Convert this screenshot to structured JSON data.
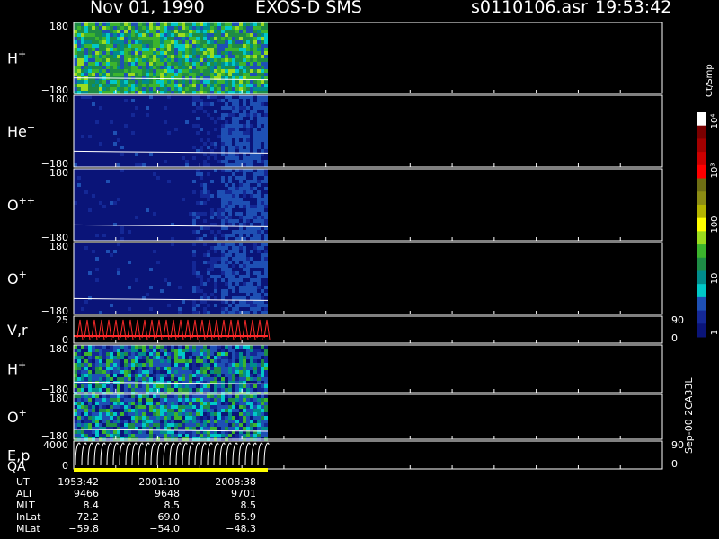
{
  "header": {
    "date": "Nov 01, 1990",
    "instrument": "EXOS-D SMS",
    "file": "s0110106.asr",
    "time": "19:53:42"
  },
  "panels": [
    {
      "label": "H",
      "sup": "+",
      "ymax": "180",
      "ymin": "−180"
    },
    {
      "label": "He",
      "sup": "+",
      "ymax": "180",
      "ymin": "−180"
    },
    {
      "label": "O",
      "sup": "++",
      "ymax": "180",
      "ymin": "−180"
    },
    {
      "label": "O",
      "sup": "+",
      "ymax": "180",
      "ymin": "−180"
    },
    {
      "label": "V,r",
      "sup": "",
      "ymax": "25",
      "ymin": "0",
      "rmax": "90",
      "rmin": "0"
    },
    {
      "label": "H",
      "sup": "+",
      "ymax": "180",
      "ymin": "−180"
    },
    {
      "label": "O",
      "sup": "+",
      "ymax": "180",
      "ymin": "−180"
    },
    {
      "label": "E,p",
      "sup": "",
      "ymax": "4000",
      "ymin": "0",
      "rmax": "90",
      "rmin": "0"
    }
  ],
  "qa_label": "QA",
  "colorbar": {
    "unit": "Ct/Smp",
    "ticks": [
      "10⁴",
      "10³",
      "100",
      "10",
      "1"
    ],
    "colors": [
      "#ffffff",
      "#7a0000",
      "#a30000",
      "#cc0000",
      "#ff0000",
      "#6e6e14",
      "#8c8c14",
      "#b4b400",
      "#ffff00",
      "#9bdc1e",
      "#3cb42d",
      "#1e8c46",
      "#008c8c",
      "#00c8c8",
      "#1e50b4",
      "#142896",
      "#0a1478"
    ]
  },
  "stamp": "Sep-00 2CA33L",
  "footer": {
    "rows": [
      {
        "name": "UT",
        "values": [
          "1953:42",
          "2001:10",
          "2008:38"
        ]
      },
      {
        "name": "ALT",
        "values": [
          "9466",
          "9648",
          "9701"
        ]
      },
      {
        "name": "MLT",
        "values": [
          "8.4",
          "8.5",
          "8.5"
        ]
      },
      {
        "name": "InLat",
        "values": [
          "72.2",
          "69.0",
          "65.9"
        ]
      },
      {
        "name": "MLat",
        "values": [
          "−59.8",
          "−54.0",
          "−48.3"
        ]
      }
    ]
  },
  "chart_data": {
    "type": "heatmap",
    "title": "Nov 01, 1990 EXOS-D SMS",
    "x": [
      "1953:42",
      "2001:10",
      "2008:38"
    ],
    "ylim": [
      -180,
      180
    ],
    "colorbar_unit": "Ct/Smp",
    "colorbar_ticks": [
      1,
      10,
      100,
      1000,
      10000
    ],
    "series": [
      {
        "name": "H+",
        "mean_level": "high",
        "ylim": [
          -180,
          180
        ]
      },
      {
        "name": "He+",
        "mean_level": "low",
        "ylim": [
          -180,
          180
        ]
      },
      {
        "name": "O++",
        "mean_level": "low",
        "ylim": [
          -180,
          180
        ]
      },
      {
        "name": "O+",
        "mean_level": "low",
        "ylim": [
          -180,
          180
        ]
      },
      {
        "name": "V,r",
        "ylim": [
          0,
          25
        ],
        "right_ylim": [
          0,
          90
        ]
      },
      {
        "name": "H+",
        "mean_level": "medium",
        "ylim": [
          -180,
          180
        ]
      },
      {
        "name": "O+",
        "mean_level": "medium",
        "ylim": [
          -180,
          180
        ]
      },
      {
        "name": "E,p",
        "ylim": [
          0,
          4000
        ],
        "right_ylim": [
          0,
          90
        ]
      }
    ],
    "data_extent_fraction": 0.33
  }
}
